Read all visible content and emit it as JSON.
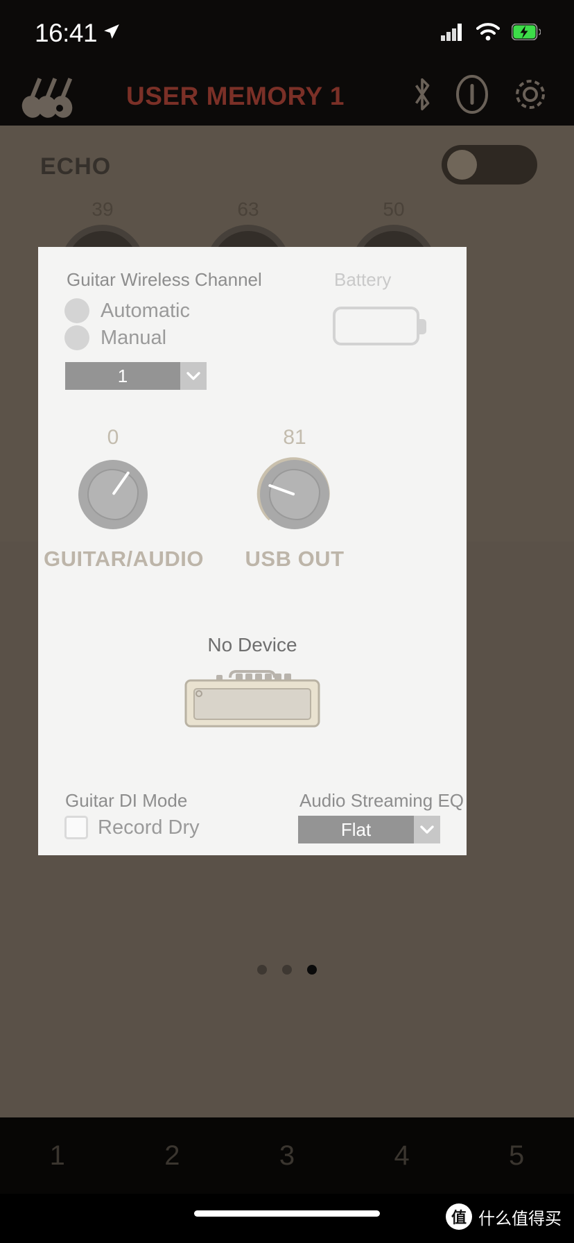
{
  "status_bar": {
    "time": "16:41",
    "location_icon": "location-arrow-icon",
    "cellular_icon": "cellular-signal-icon",
    "wifi_icon": "wifi-icon",
    "battery_icon": "battery-charging-icon",
    "battery_color": "#3ddc49"
  },
  "header": {
    "guitars_icon": "guitars-icon",
    "title": "USER MEMORY 1",
    "title_color": "#7b3027",
    "bluetooth_icon": "bluetooth-icon",
    "shield_icon": "shield-icon",
    "settings_icon": "gear-icon"
  },
  "background_app": {
    "effect_name": "ECHO",
    "effect_toggle_state": "off",
    "knobs": [
      {
        "value": "39"
      },
      {
        "value": "63"
      },
      {
        "value": "50"
      }
    ],
    "page_dots": {
      "count": 3,
      "active_index": 2
    },
    "footer_tabs": [
      "1",
      "2",
      "3",
      "4",
      "5"
    ]
  },
  "modal": {
    "wireless": {
      "section_label": "Guitar Wireless Channel",
      "options": [
        {
          "label": "Automatic",
          "selected": false
        },
        {
          "label": "Manual",
          "selected": false
        }
      ],
      "channel_value": "1",
      "chevron_icon": "chevron-down-icon"
    },
    "battery": {
      "label": "Battery",
      "icon": "battery-empty-icon",
      "level_percent": 0
    },
    "knobs": [
      {
        "name": "guitar-audio",
        "value": "0",
        "label": "GUITAR/AUDIO",
        "arc_percent": 0
      },
      {
        "name": "usb-out",
        "value": "81",
        "label": "USB OUT",
        "arc_percent": 81
      }
    ],
    "device": {
      "status_text": "No Device",
      "image_name": "amplifier-illustration"
    },
    "guitar_di": {
      "section_label": "Guitar DI Mode",
      "checkbox_label": "Record Dry",
      "checked": false
    },
    "streaming_eq": {
      "section_label": "Audio Streaming EQ",
      "value": "Flat",
      "chevron_icon": "chevron-down-icon"
    }
  },
  "watermark": {
    "badge": "值",
    "text": "什么值得买"
  },
  "colors": {
    "modal_bg": "#f4f4f3",
    "app_bg": "#5a5148",
    "accent_knob": "#c3bcae",
    "select_bg": "#949494",
    "title_red": "#7b3027"
  }
}
